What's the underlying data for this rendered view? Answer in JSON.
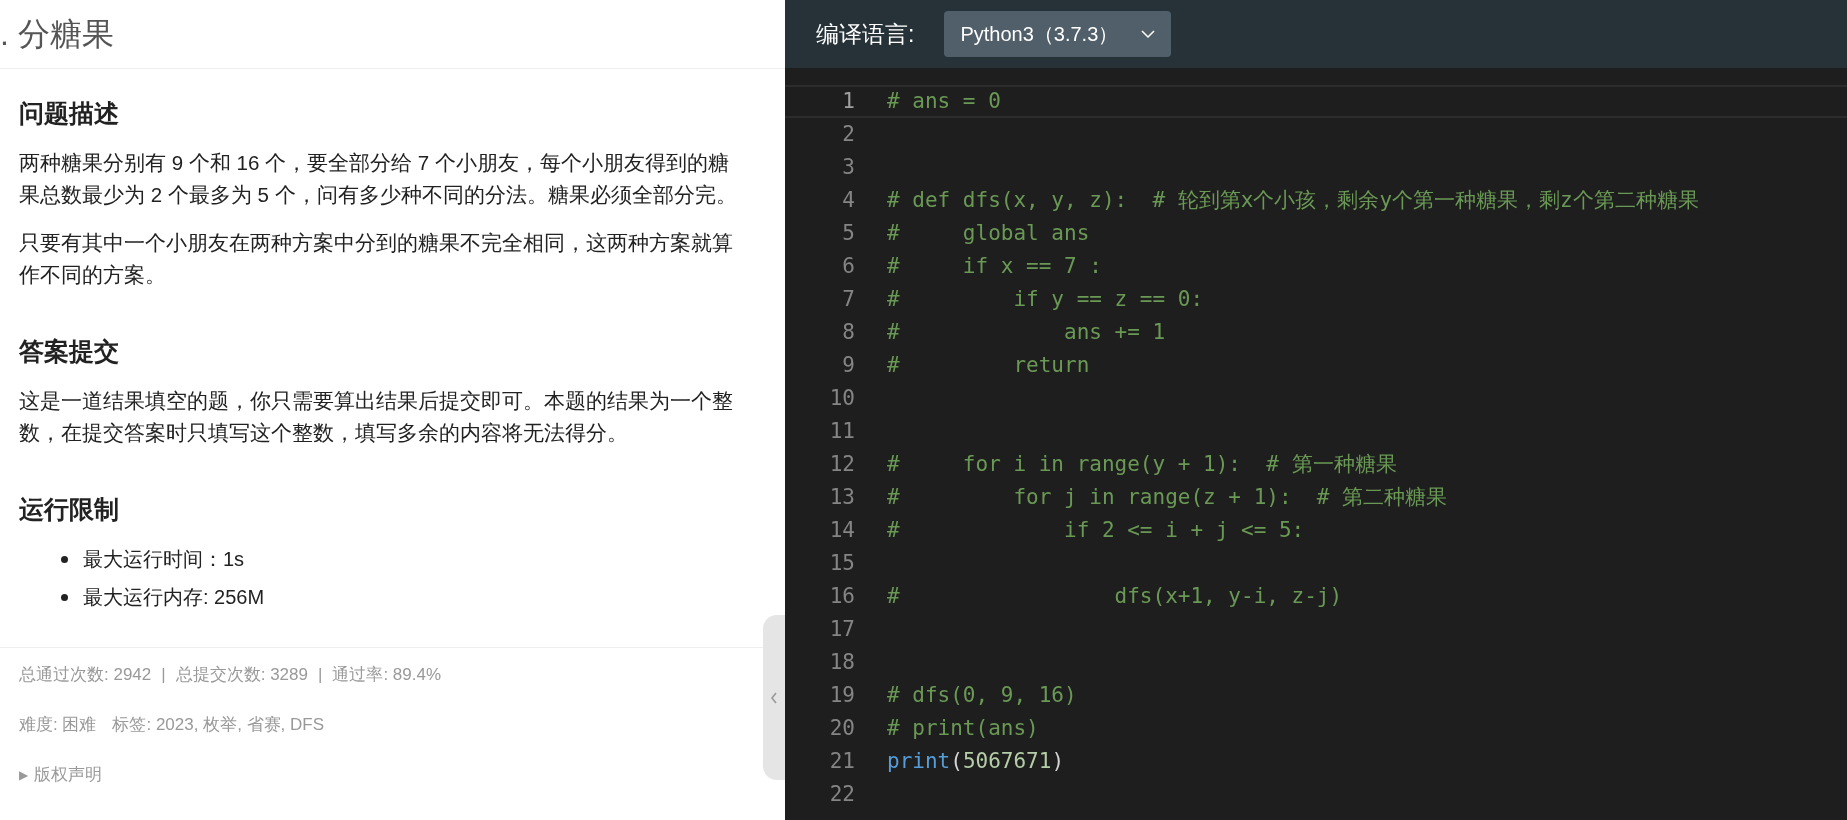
{
  "problem": {
    "title": ". 分糖果",
    "sections": [
      {
        "heading": "问题描述",
        "paragraphs": [
          "两种糖果分别有 9 个和 16 个，要全部分给 7 个小朋友，每个小朋友得到的糖果总数最少为 2 个最多为 5 个，问有多少种不同的分法。糖果必须全部分完。",
          "只要有其中一个小朋友在两种方案中分到的糖果不完全相同，这两种方案就算作不同的方案。"
        ]
      },
      {
        "heading": "答案提交",
        "paragraphs": [
          "这是一道结果填空的题，你只需要算出结果后提交即可。本题的结果为一个整数，在提交答案时只填写这个整数，填写多余的内容将无法得分。"
        ]
      },
      {
        "heading": "运行限制",
        "bullets": [
          "最大运行时间：1s",
          "最大运行内存: 256M"
        ]
      }
    ],
    "stats": [
      "总通过次数: 2942",
      "|",
      "总提交次数: 3289",
      "|",
      "通过率: 89.4%"
    ],
    "difficulty": "难度: 困难",
    "tags": "标签: 2023, 枚举, 省赛, DFS",
    "copyright_arrow": "▶",
    "copyright": "版权声明"
  },
  "editor": {
    "language_label": "编译语言:",
    "language": "Python3（3.7.3）",
    "lines": [
      {
        "number": "1",
        "current": true,
        "tokens": [
          {
            "kind": "comment",
            "text": "# ans = 0"
          }
        ]
      },
      {
        "number": "2",
        "current": false
      },
      {
        "number": "3",
        "current": false
      },
      {
        "number": "4",
        "current": false,
        "tokens": [
          {
            "kind": "comment",
            "text": "# def dfs(x, y, z):  # 轮到第x个小孩，剩余y个第一种糖果，剩z个第二种糖果"
          }
        ]
      },
      {
        "number": "5",
        "current": false,
        "tokens": [
          {
            "kind": "comment",
            "text": "#     global ans"
          }
        ]
      },
      {
        "number": "6",
        "current": false,
        "tokens": [
          {
            "kind": "comment",
            "text": "#     if x == 7 :"
          }
        ]
      },
      {
        "number": "7",
        "current": false,
        "tokens": [
          {
            "kind": "comment",
            "text": "#         if y == z == 0:"
          }
        ]
      },
      {
        "number": "8",
        "current": false,
        "tokens": [
          {
            "kind": "comment",
            "text": "#             ans += 1"
          }
        ]
      },
      {
        "number": "9",
        "current": false,
        "tokens": [
          {
            "kind": "comment",
            "text": "#         return"
          }
        ]
      },
      {
        "number": "10",
        "current": false
      },
      {
        "number": "11",
        "current": false
      },
      {
        "number": "12",
        "current": false,
        "tokens": [
          {
            "kind": "comment",
            "text": "#     for i in range(y + 1):  # 第一种糖果"
          }
        ]
      },
      {
        "number": "13",
        "current": false,
        "tokens": [
          {
            "kind": "comment",
            "text": "#         for j in range(z + 1):  # 第二种糖果"
          }
        ]
      },
      {
        "number": "14",
        "current": false,
        "tokens": [
          {
            "kind": "comment",
            "text": "#             if 2 <= i + j <= 5:"
          }
        ]
      },
      {
        "number": "15",
        "current": false
      },
      {
        "number": "16",
        "current": false,
        "tokens": [
          {
            "kind": "comment",
            "text": "#                 dfs(x+1, y-i, z-j)"
          }
        ]
      },
      {
        "number": "17",
        "current": false
      },
      {
        "number": "18",
        "current": false
      },
      {
        "number": "19",
        "current": false,
        "tokens": [
          {
            "kind": "comment",
            "text": "# dfs(0, 9, 16)"
          }
        ]
      },
      {
        "number": "20",
        "current": false,
        "tokens": [
          {
            "kind": "comment",
            "text": "# print(ans)"
          }
        ]
      },
      {
        "number": "21",
        "current": false,
        "tokens": [
          {
            "kind": "builtin",
            "text": "print"
          },
          {
            "kind": "punct",
            "text": "("
          },
          {
            "kind": "number",
            "text": "5067671"
          },
          {
            "kind": "punct",
            "text": ")"
          }
        ]
      },
      {
        "number": "22",
        "current": false
      }
    ]
  }
}
